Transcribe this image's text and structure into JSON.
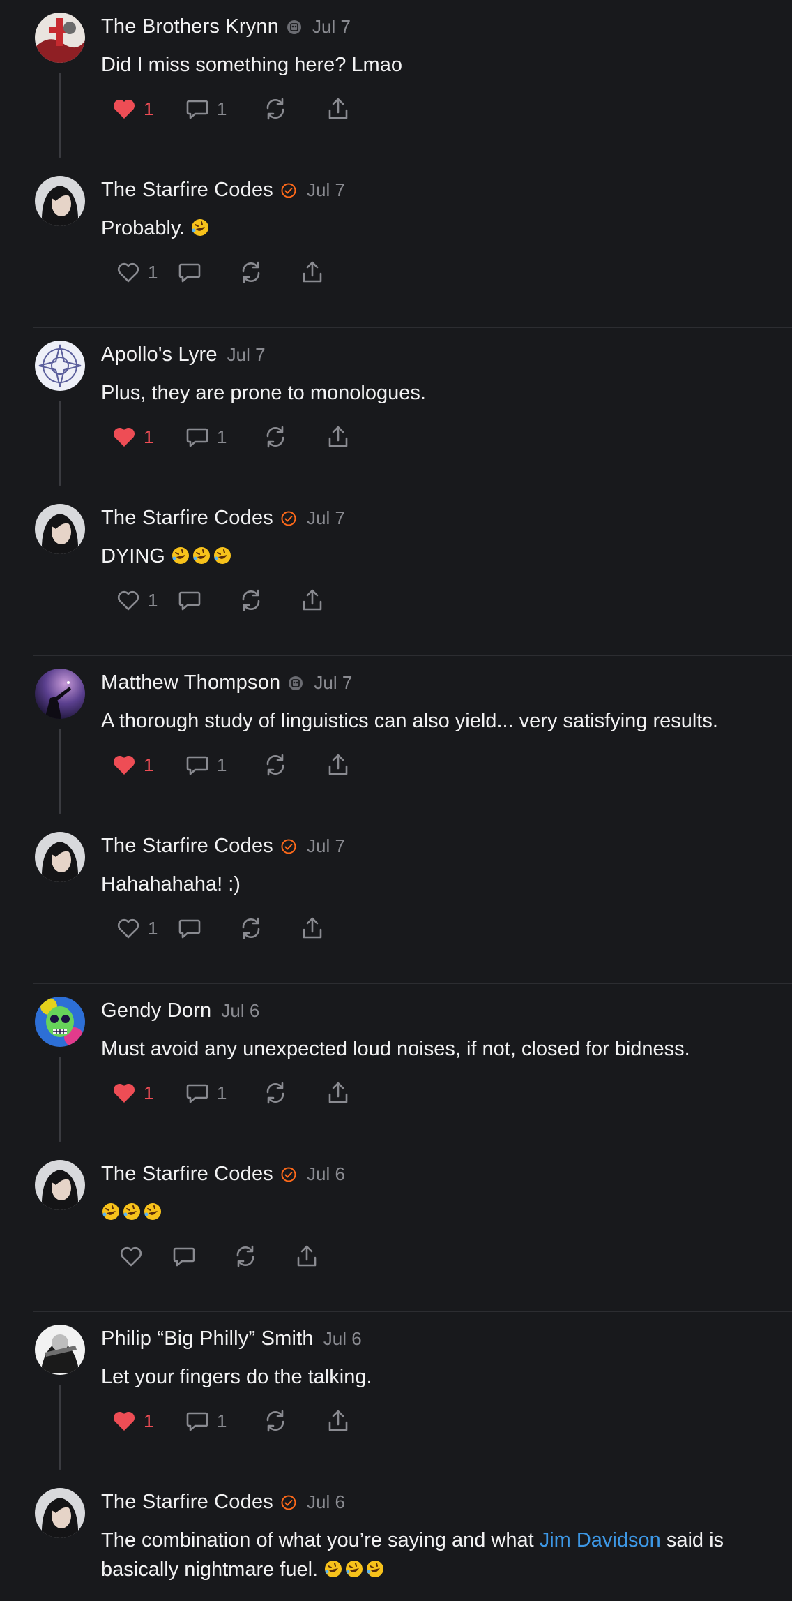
{
  "colors": {
    "background": "#18191c",
    "text": "#f2f2f3",
    "muted": "#8a8b91",
    "like": "#ee4d55",
    "verified": "#ff6a1a",
    "link": "#3d98e6",
    "divider": "#2c2d31"
  },
  "threads": [
    {
      "parent": {
        "name": "The Brothers Krynn",
        "badge": "bot-badge-icon",
        "date": "Jul 7",
        "text": "Did I miss something here? Lmao",
        "likes": "1",
        "replies": "1",
        "liked": true
      },
      "reply": {
        "name": "The Starfire Codes",
        "badge": "verified-badge-icon",
        "date": "Jul 7",
        "text": "Probably.",
        "emoji_count": 1,
        "likes": "1",
        "replies": "",
        "liked": false
      }
    },
    {
      "parent": {
        "name": "Apollo's Lyre",
        "badge": "",
        "date": "Jul 7",
        "text": "Plus, they are prone to monologues.",
        "likes": "1",
        "replies": "1",
        "liked": true
      },
      "reply": {
        "name": "The Starfire Codes",
        "badge": "verified-badge-icon",
        "date": "Jul 7",
        "text": "DYING",
        "emoji_count": 3,
        "likes": "1",
        "replies": "",
        "liked": false
      }
    },
    {
      "parent": {
        "name": "Matthew Thompson",
        "badge": "bot-badge-icon",
        "date": "Jul 7",
        "text": "A thorough study of linguistics can also yield... very satisfying results.",
        "likes": "1",
        "replies": "1",
        "liked": true
      },
      "reply": {
        "name": "The Starfire Codes",
        "badge": "verified-badge-icon",
        "date": "Jul 7",
        "text": "Hahahahaha! :)",
        "emoji_count": 0,
        "likes": "1",
        "replies": "",
        "liked": false
      }
    },
    {
      "parent": {
        "name": "Gendy Dorn",
        "badge": "",
        "date": "Jul 6",
        "text": "Must avoid any unexpected loud noises, if not, closed for bidness.",
        "likes": "1",
        "replies": "1",
        "liked": true
      },
      "reply": {
        "name": "The Starfire Codes",
        "badge": "verified-badge-icon",
        "date": "Jul 6",
        "text": "",
        "emoji_count": 3,
        "likes": "",
        "replies": "",
        "liked": false
      }
    },
    {
      "parent": {
        "name": "Philip “Big Philly” Smith",
        "badge": "",
        "date": "Jul 6",
        "text": "Let your fingers do the talking.",
        "likes": "1",
        "replies": "1",
        "liked": true
      },
      "reply": {
        "name": "The Starfire Codes",
        "badge": "verified-badge-icon",
        "date": "Jul 6",
        "text_before": "The combination of what you’re saying and what ",
        "mention": "Jim Davidson",
        "text_after": " said is basically nightmare fuel.",
        "emoji_count": 3
      }
    }
  ]
}
